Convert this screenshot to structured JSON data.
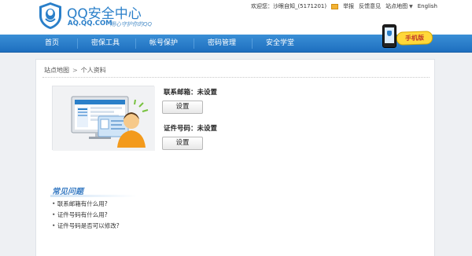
{
  "header": {
    "logo_title": "QQ安全中心",
    "logo_domain": "AQ.QQ.COM",
    "logo_slogan": "用心守护你的QQ",
    "top_links": {
      "welcome": "欢迎您：沙眼自知_(5171201)",
      "report": "举报",
      "feedback": "反馈意见",
      "sitemap": "站点地图",
      "language": "English"
    }
  },
  "nav": {
    "items": [
      "首页",
      "密保工具",
      "帐号保护",
      "密码管理",
      "安全学堂"
    ]
  },
  "phone_badge": {
    "label": "手机版"
  },
  "breadcrumb": {
    "root": "站点地图",
    "separator": ">",
    "current": "个人资料"
  },
  "profile": {
    "email_label": "联系邮箱：未设置",
    "email_button": "设置",
    "id_label": "证件号码：未设置",
    "id_button": "设置"
  },
  "faq": {
    "title": "常见问题",
    "items": [
      "联系邮箱有什么用?",
      "证件号码有什么用?",
      "证件号码是否可以修改?"
    ]
  },
  "colors": {
    "brand": "#2a7fc9",
    "nav_bg": "#2a7fc9",
    "faq_title": "#3b7dc4"
  },
  "icons": {
    "logo": "qq-shield-logo-icon",
    "mail": "mail-icon",
    "phone": "phone-icon",
    "illustration": "computer-user-illustration"
  }
}
